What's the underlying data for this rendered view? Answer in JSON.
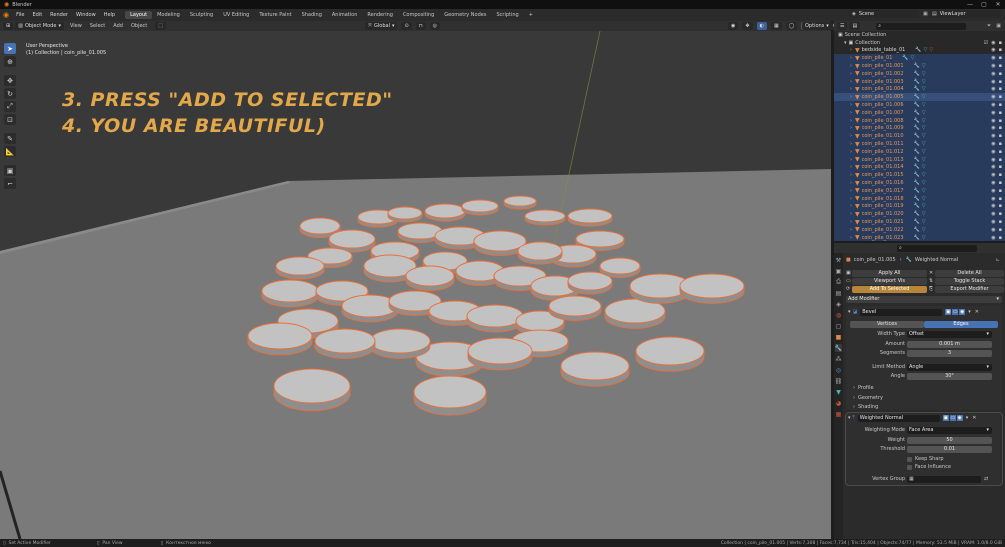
{
  "window": {
    "title": "Blender",
    "controls": [
      "—",
      "▢",
      "✕"
    ]
  },
  "menu": [
    "File",
    "Edit",
    "Render",
    "Window",
    "Help"
  ],
  "workspaces": [
    {
      "label": "Layout",
      "active": true
    },
    {
      "label": "Modeling"
    },
    {
      "label": "Sculpting"
    },
    {
      "label": "UV Editing"
    },
    {
      "label": "Texture Paint"
    },
    {
      "label": "Shading"
    },
    {
      "label": "Animation"
    },
    {
      "label": "Rendering"
    },
    {
      "label": "Compositing"
    },
    {
      "label": "Geometry Nodes"
    },
    {
      "label": "Scripting"
    }
  ],
  "add_workspace": "+",
  "scene": {
    "name": "Scene",
    "viewlayer": "ViewLayer"
  },
  "viewport_header": {
    "mode": "Object Mode",
    "menus": [
      "View",
      "Select",
      "Add",
      "Object"
    ],
    "transform": "Global",
    "options": "Options"
  },
  "viewport": {
    "perspective": "User Perspective",
    "context": "(1) Collection | coin_pile_01.005",
    "annotation_line1": "3. PRESS \"ADD TO SELECTED\"",
    "annotation_line2": "4. YOU ARE BEAUTIFUL)",
    "annotation_color": "#e3a84a",
    "selection_color": "#e8703a"
  },
  "outliner": {
    "scene_collection": "Scene Collection",
    "collection": "Collection",
    "items": [
      {
        "name": "bedside_table_01",
        "sel": false
      },
      {
        "name": "coin_pile_01",
        "sel": true
      },
      {
        "name": "coin_pile_01.001",
        "sel": true
      },
      {
        "name": "coin_pile_01.002",
        "sel": true
      },
      {
        "name": "coin_pile_01.003",
        "sel": true
      },
      {
        "name": "coin_pile_01.004",
        "sel": true
      },
      {
        "name": "coin_pile_01.005",
        "sel": true,
        "active": true
      },
      {
        "name": "coin_pile_01.006",
        "sel": true
      },
      {
        "name": "coin_pile_01.007",
        "sel": true
      },
      {
        "name": "coin_pile_01.008",
        "sel": true
      },
      {
        "name": "coin_pile_01.009",
        "sel": true
      },
      {
        "name": "coin_pile_01.010",
        "sel": true
      },
      {
        "name": "coin_pile_01.011",
        "sel": true
      },
      {
        "name": "coin_pile_01.012",
        "sel": true
      },
      {
        "name": "coin_pile_01.013",
        "sel": true
      },
      {
        "name": "coin_pile_01.014",
        "sel": true
      },
      {
        "name": "coin_pile_01.015",
        "sel": true
      },
      {
        "name": "coin_pile_01.016",
        "sel": true
      },
      {
        "name": "coin_pile_01.017",
        "sel": true
      },
      {
        "name": "coin_pile_01.018",
        "sel": true
      },
      {
        "name": "coin_pile_01.019",
        "sel": true
      },
      {
        "name": "coin_pile_01.020",
        "sel": true
      },
      {
        "name": "coin_pile_01.021",
        "sel": true
      },
      {
        "name": "coin_pile_01.022",
        "sel": true
      },
      {
        "name": "coin_pile_01.023",
        "sel": true
      }
    ]
  },
  "properties": {
    "object": "coin_pile_01.005",
    "modifier_context": "Weighted Normal",
    "actions": {
      "apply_all": "Apply All",
      "delete_all": "Delete All",
      "viewport_vis": "Viewport Vis",
      "toggle_stack": "Toggle Stack",
      "add_to_selected": "Add To Selected",
      "export_modifier": "Export Modifier"
    },
    "add_modifier": "Add Modifier",
    "bevel": {
      "name": "Bevel",
      "seg_vertices": "Vertices",
      "seg_edges": "Edges",
      "width_type_label": "Width Type",
      "width_type": "Offset",
      "amount_label": "Amount",
      "amount": "0.001 m",
      "segments_label": "Segments",
      "segments": "3",
      "limit_method_label": "Limit Method",
      "limit_method": "Angle",
      "angle_label": "Angle",
      "angle": "30°",
      "profile": "Profile",
      "geometry": "Geometry",
      "shading": "Shading"
    },
    "weighted": {
      "name": "Weighted Normal",
      "mode_label": "Weighting Mode",
      "mode": "Face Area",
      "weight_label": "Weight",
      "weight": "50",
      "threshold_label": "Threshold",
      "threshold": "0.01",
      "keep_sharp": "Keep Sharp",
      "face_influence": "Face Influence",
      "vertex_group_label": "Vertex Group"
    }
  },
  "status": {
    "left1": "Set Active Modifier",
    "left2": "Pan View",
    "left3": "Контекстное меню",
    "right": "Collection | coin_pile_01.005 | Verts:7,308 | Faces:7,734 | Tris:15,404 | Objects:74/77 | Memory: 53.5 MiB | VRAM: 1.0/8.0 GiB"
  }
}
